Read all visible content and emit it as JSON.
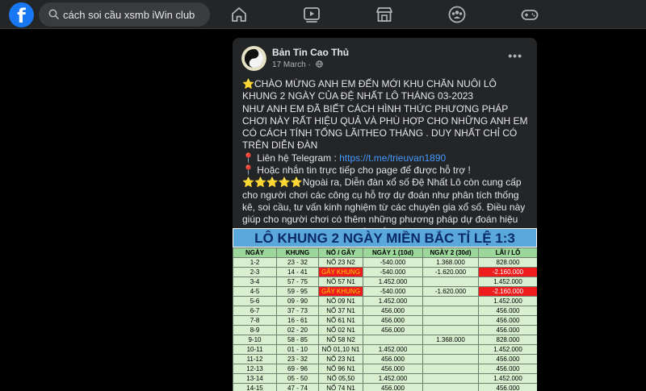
{
  "topbar": {
    "logo": "f",
    "search_value": "cách soi cầu xsmb iWin club",
    "nav_icons": [
      "home-icon",
      "video-icon",
      "marketplace-icon",
      "groups-icon",
      "gaming-icon"
    ]
  },
  "post": {
    "author": "Bản Tin Cao Thủ",
    "date": "17 March",
    "menu": "•••",
    "paragraphs": [
      "⭐CHÀO MỪNG ANH EM ĐẾN MỚI KHU CHĂN NUÔI LÔ KHUNG 2 NGÀY CỦA ĐỆ NHẤT LÔ THÁNG 03-2023\nNHƯ ANH EM ĐÃ BIẾT CÁCH HÌNH THỨC PHƯƠNG PHÁP CHƠI NÀY RẤT HIỆU QUẢ VÀ PHÙ HỢP CHO NHỮNG ANH EM CÓ CÁCH TÍNH TỔNG LÃITHEO THÁNG . DUY NHẤT CHỈ CÓ TRÊN DIỄN ĐÀN"
    ],
    "contact_label": "📍 Liên hệ Telegram : ",
    "contact_link": "https://t.me/trieuvan1890",
    "inbox_line": "📍 Hoặc nhắn tin trực tiếp cho page để được hỗ trợ !",
    "stars": "⭐⭐⭐⭐⭐",
    "promo": "Ngoài ra, Diễn đàn xổ số Đệ Nhất Lô còn cung cấp cho người chơi các công cụ hỗ trợ dự đoán như phân tích thống kê, soi cầu, tư vấn kinh nghiệm từ các chuyên gia xổ số. Điều này giúp cho người chơi có thêm những phương pháp dự đoán hiệu quả hơn, tăng khả năng chiến thắng."
  },
  "table": {
    "title": "LÔ KHUNG 2 NGÀY MIỀN BẮC TỈ LỆ 1:3",
    "headers": [
      "NGÀY",
      "KHUNG",
      "NỔ / GÃY",
      "NGÀY 1 (10d)",
      "NGÀY 2 (30d)",
      "LÃI / LỖ"
    ],
    "rows": [
      [
        "1-2",
        "23 - 32",
        "NỔ 23 N2",
        "-540.000",
        "1.368.000",
        "828.000"
      ],
      [
        "2-3",
        "14 - 41",
        "GÃY KHUNG",
        "-540.000",
        "-1.620.000",
        "-2.160.000"
      ],
      [
        "3-4",
        "57 - 75",
        "NỔ 57 N1",
        "1.452.000",
        "",
        "1.452.000"
      ],
      [
        "4-5",
        "59 - 95",
        "GÃY KHUNG",
        "-540.000",
        "-1.620.000",
        "-2.160.000"
      ],
      [
        "5-6",
        "09 - 90",
        "NỔ 09  N1",
        "1.452.000",
        "",
        "1.452.000"
      ],
      [
        "6-7",
        "37 - 73",
        "NỔ 37 N1",
        "456.000",
        "",
        "456.000"
      ],
      [
        "7-8",
        "16 - 61",
        "NỔ 61 N1",
        "456.000",
        "",
        "456.000"
      ],
      [
        "8-9",
        "02 - 20",
        "NỔ 02 N1",
        "456.000",
        "",
        "456.000"
      ],
      [
        "9-10",
        "58 - 85",
        "NỔ 58 N2",
        "",
        "1.368.000",
        "828.000"
      ],
      [
        "10-11",
        "01 - 10",
        "NỔ 01,10 N1",
        "1.452.000",
        "",
        "1.452.000"
      ],
      [
        "11-12",
        "23 - 32",
        "NỔ 23 N1",
        "456.000",
        "",
        "456.000"
      ],
      [
        "12-13",
        "69 - 96",
        "NỔ 96 N1",
        "456.000",
        "",
        "456.000"
      ],
      [
        "13-14",
        "05 - 50",
        "NỔ 05,50",
        "1.452.000",
        "",
        "1.452.000"
      ],
      [
        "14-15",
        "47 - 74",
        "NỔ 74 N1",
        "456.000",
        "",
        "456.000"
      ]
    ],
    "loss_rows": [
      1,
      3
    ],
    "colors": {
      "header_bg": "#9bd79b",
      "cell_bg": "#d8f0cf",
      "loss_bg": "#ee1c1c",
      "title_bg": "#5aa7dc",
      "title_text": "#0a2a66"
    }
  }
}
